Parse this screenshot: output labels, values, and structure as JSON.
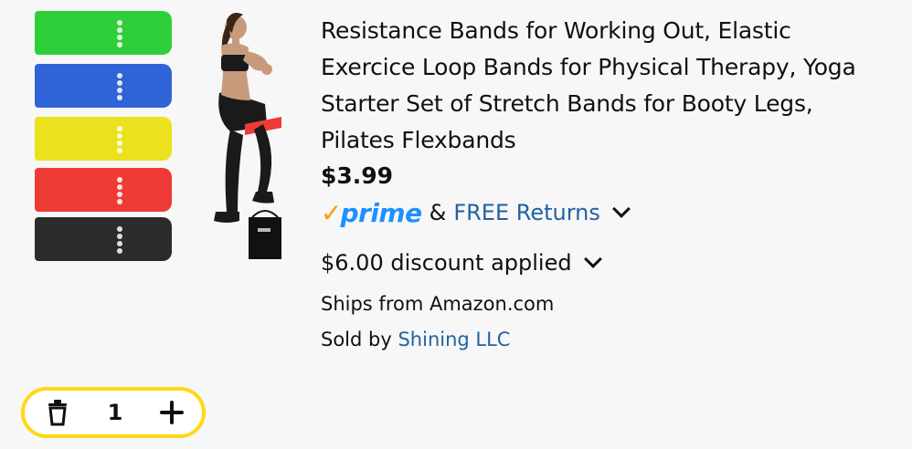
{
  "product": {
    "image_alt": "Resistance bands product image",
    "title": "Resistance Bands for Working Out, Elastic Exercice Loop Bands for Physical Therapy, Yoga Starter Set of Stretch Bands for Booty Legs, Pilates Flexbands",
    "price": "$3.99",
    "prime_label": "prime",
    "amp": "&",
    "free_returns": "FREE Returns",
    "discount": "$6.00 discount applied",
    "ships_from": "Ships from Amazon.com",
    "sold_by_prefix": "Sold by",
    "seller": "Shining LLC"
  },
  "quantity": {
    "value": "1",
    "decrement_icon": "trash-icon",
    "increment_icon": "plus-icon"
  },
  "colors": {
    "prime_orange": "#ff9900",
    "prime_blue": "#1e90ff",
    "link_blue": "#2162a1",
    "stepper_border": "#ffd814",
    "band_colors": [
      "#2fcf3a",
      "#2f63d6",
      "#ece11d",
      "#ef3b35",
      "#2b2b2b"
    ]
  }
}
